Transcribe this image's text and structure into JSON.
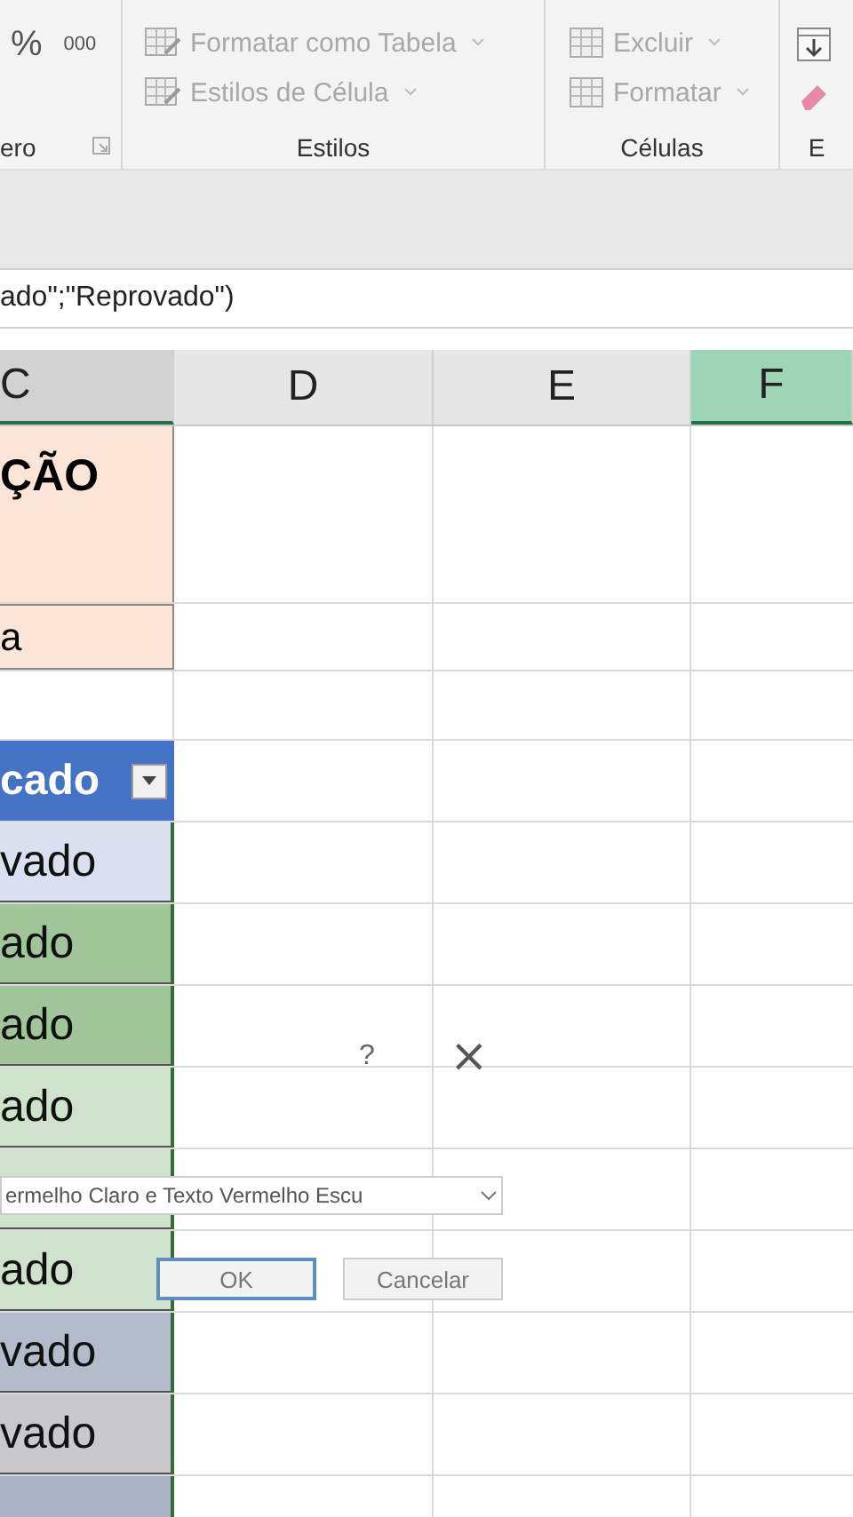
{
  "ribbon": {
    "number_group": {
      "label": "ero",
      "buttons": [
        "%",
        "000"
      ]
    },
    "styles_group": {
      "label": "Estilos",
      "items": [
        "Formatar como Tabela",
        "Estilos de Célula"
      ]
    },
    "cells_group": {
      "label": "Células",
      "items": [
        "Excluir",
        "Formatar"
      ]
    },
    "editing_group": {
      "label": "E"
    }
  },
  "formula_bar": {
    "text": "ado\";\"Reprovado\")"
  },
  "columns": [
    {
      "label": "C",
      "selected": false,
      "in_range": true
    },
    {
      "label": "D",
      "selected": false,
      "in_range": false
    },
    {
      "label": "E",
      "selected": false,
      "in_range": false
    },
    {
      "label": "F",
      "selected": true,
      "in_range": false
    }
  ],
  "rows": [
    {
      "kind": "title",
      "text": "ÇÃO"
    },
    {
      "kind": "subtitle",
      "text": "a"
    },
    {
      "kind": "blank"
    },
    {
      "kind": "header",
      "text": "cado"
    },
    {
      "kind": "data",
      "text": "vado",
      "color": "#dae0ef"
    },
    {
      "kind": "data",
      "text": "ado",
      "color": "#9fc598"
    },
    {
      "kind": "data",
      "text": "ado",
      "color": "#9fc598"
    },
    {
      "kind": "data",
      "text": "ado",
      "color": "#cfe2cb"
    },
    {
      "kind": "data",
      "color": "#cfe2cb"
    },
    {
      "kind": "data",
      "text": "ado",
      "color": "#cfe2cb"
    },
    {
      "kind": "data",
      "text": "vado",
      "color": "#b4bccb"
    },
    {
      "kind": "data",
      "text": "vado",
      "color": "#c9c9cd"
    },
    {
      "kind": "data",
      "color": "#aab3c6"
    }
  ],
  "dialog": {
    "help": "?",
    "close": "×",
    "field": {
      "value": "ermelho Claro e Texto Vermelho Escu"
    },
    "buttons": [
      {
        "label": "OK",
        "selected": true
      },
      {
        "label": "Cancelar",
        "selected": false
      }
    ]
  }
}
